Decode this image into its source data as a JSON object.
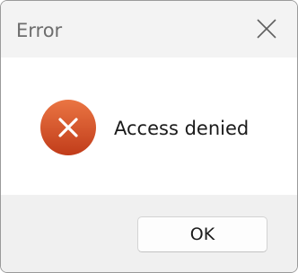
{
  "window": {
    "title": "Error"
  },
  "titlebar": {
    "close_icon": "close-icon"
  },
  "content": {
    "icon": "error-icon",
    "message": "Access denied"
  },
  "footer": {
    "ok_label": "OK"
  },
  "colors": {
    "error_icon_top": "#e8703f",
    "error_icon_bottom": "#c4401c",
    "titlebar_bg": "#f3f3f3",
    "footer_bg": "#f0f0f0"
  }
}
